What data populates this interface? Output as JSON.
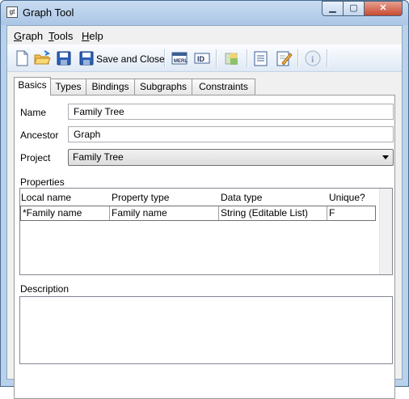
{
  "window": {
    "title": "Graph Tool",
    "app_icon_glyph": "gt",
    "minimize_glyph": "▁",
    "maximize_glyph": "▢",
    "close_glyph": "✕"
  },
  "menu": [
    {
      "label": "Graph",
      "mnemonic": "G",
      "rest": "raph"
    },
    {
      "label": "Tools",
      "mnemonic": "T",
      "rest": "ools"
    },
    {
      "label": "Help",
      "mnemonic": "H",
      "rest": "elp"
    }
  ],
  "toolbar": {
    "save_and_close_label": "Save and Close",
    "icons": [
      "new-document-icon",
      "open-folder-icon",
      "save-icon",
      "save-and-close-icon",
      "merl-icon",
      "id-icon",
      "image-icon",
      "list-icon",
      "edit-icon",
      "info-icon"
    ]
  },
  "tabs": [
    {
      "label": "Basics",
      "active": true
    },
    {
      "label": "Types",
      "active": false
    },
    {
      "label": "Bindings",
      "active": false
    },
    {
      "label": "Subgraphs",
      "active": false
    },
    {
      "label": "Constraints",
      "active": false
    }
  ],
  "form": {
    "name_label": "Name",
    "name_value": "Family Tree",
    "ancestor_label": "Ancestor",
    "ancestor_value": "Graph",
    "project_label": "Project",
    "project_value": "Family Tree",
    "properties_label": "Properties",
    "description_label": "Description"
  },
  "properties_table": {
    "columns": [
      "Local name",
      "Property type",
      "Data type",
      "Unique?"
    ],
    "rows": [
      [
        "*Family name",
        "Family name",
        "String (Editable List)",
        "F"
      ]
    ]
  },
  "colors": {
    "title_bar": "#c9dcf2",
    "close_button": "#c84b32"
  }
}
